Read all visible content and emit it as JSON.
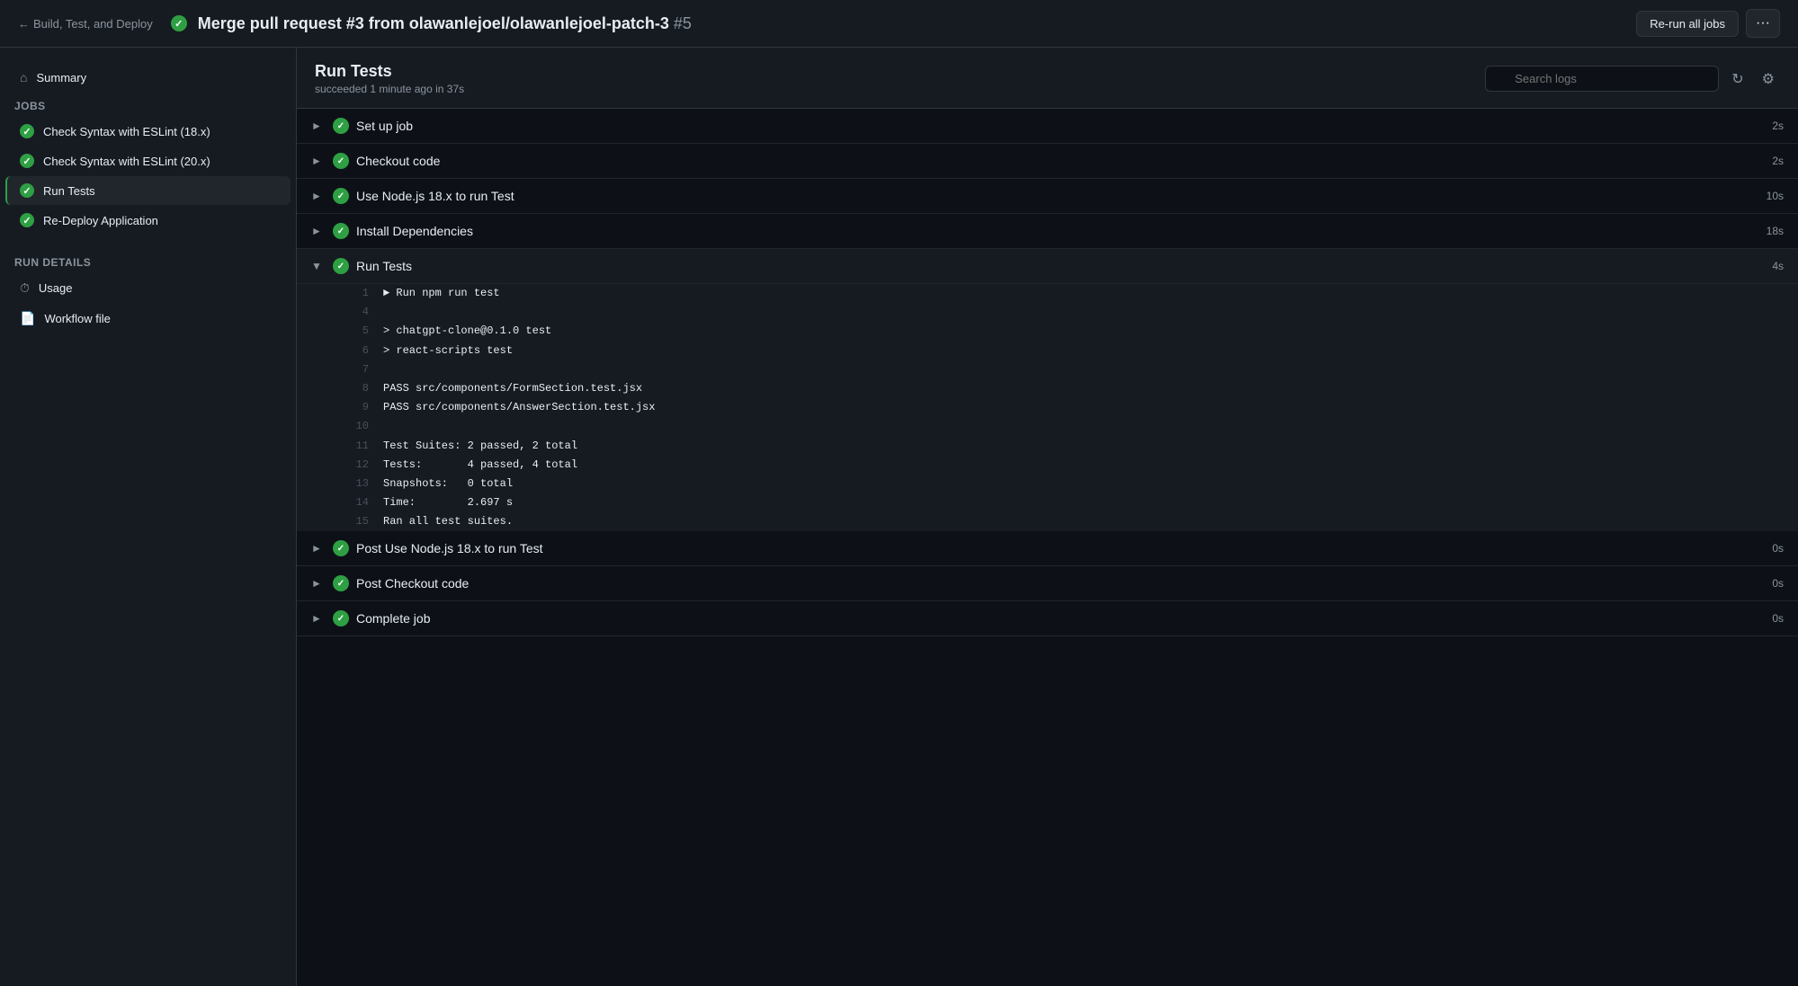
{
  "header": {
    "back_text": "Build, Test, and Deploy",
    "title": "Merge pull request #3 from olawanlejoel/olawanlejoel-patch-3",
    "run_number": "#5",
    "rerun_label": "Re-run all jobs",
    "more_label": "···"
  },
  "sidebar": {
    "summary_label": "Summary",
    "jobs_section_label": "Jobs",
    "jobs": [
      {
        "id": "check-eslint-18",
        "label": "Check Syntax with ESLint (18.x)",
        "status": "success"
      },
      {
        "id": "check-eslint-20",
        "label": "Check Syntax with ESLint (20.x)",
        "status": "success"
      },
      {
        "id": "run-tests",
        "label": "Run Tests",
        "status": "success",
        "active": true
      },
      {
        "id": "redeploy",
        "label": "Re-Deploy Application",
        "status": "success"
      }
    ],
    "run_details_label": "Run details",
    "run_details": [
      {
        "id": "usage",
        "label": "Usage",
        "icon": "⏱"
      },
      {
        "id": "workflow-file",
        "label": "Workflow file",
        "icon": "📄"
      }
    ]
  },
  "main": {
    "panel_title": "Run Tests",
    "panel_subtitle": "succeeded 1 minute ago in 37s",
    "search_placeholder": "Search logs",
    "steps": [
      {
        "id": "set-up-job",
        "label": "Set up job",
        "duration": "2s",
        "expanded": false
      },
      {
        "id": "checkout-code",
        "label": "Checkout code",
        "duration": "2s",
        "expanded": false
      },
      {
        "id": "use-nodejs",
        "label": "Use Node.js 18.x to run Test",
        "duration": "10s",
        "expanded": false
      },
      {
        "id": "install-deps",
        "label": "Install Dependencies",
        "duration": "18s",
        "expanded": false
      },
      {
        "id": "run-tests",
        "label": "Run Tests",
        "duration": "4s",
        "expanded": true
      },
      {
        "id": "post-use-nodejs",
        "label": "Post Use Node.js 18.x to run Test",
        "duration": "0s",
        "expanded": false
      },
      {
        "id": "post-checkout",
        "label": "Post Checkout code",
        "duration": "0s",
        "expanded": false
      },
      {
        "id": "complete-job",
        "label": "Complete job",
        "duration": "0s",
        "expanded": false
      }
    ],
    "log_lines": [
      {
        "num": "1",
        "content": "▶ Run npm run test"
      },
      {
        "num": "4",
        "content": ""
      },
      {
        "num": "5",
        "content": "> chatgpt-clone@0.1.0 test"
      },
      {
        "num": "6",
        "content": "> react-scripts test"
      },
      {
        "num": "7",
        "content": ""
      },
      {
        "num": "8",
        "content": "PASS src/components/FormSection.test.jsx"
      },
      {
        "num": "9",
        "content": "PASS src/components/AnswerSection.test.jsx"
      },
      {
        "num": "10",
        "content": ""
      },
      {
        "num": "11",
        "content": "Test Suites: 2 passed, 2 total"
      },
      {
        "num": "12",
        "content": "Tests:       4 passed, 4 total"
      },
      {
        "num": "13",
        "content": "Snapshots:   0 total"
      },
      {
        "num": "14",
        "content": "Time:        2.697 s"
      },
      {
        "num": "15",
        "content": "Ran all test suites."
      }
    ]
  }
}
